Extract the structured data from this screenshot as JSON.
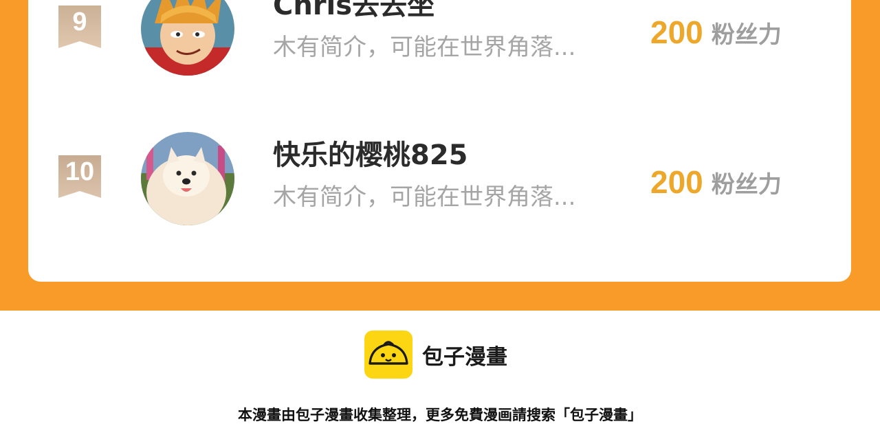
{
  "ranking": {
    "rows": [
      {
        "rank": "9",
        "username": "Chris去去坐",
        "bio": "木有简介，可能在世界角落...",
        "fans_count": "200",
        "fans_label": "粉丝力"
      },
      {
        "rank": "10",
        "username": "快乐的樱桃825",
        "bio": "木有简介，可能在世界角落...",
        "fans_count": "200",
        "fans_label": "粉丝力"
      }
    ]
  },
  "brand": {
    "name": "包子漫畫",
    "logo_icon": "bun-mascot-icon"
  },
  "footer": {
    "note": "本漫畫由包子漫畫收集整理，更多免費漫画請搜索「包子漫畫」"
  },
  "colors": {
    "frame_orange": "#f99b29",
    "fans_count": "#eda72a",
    "badge_tan": "#c9aa8e",
    "logo_yellow": "#fcd513"
  }
}
